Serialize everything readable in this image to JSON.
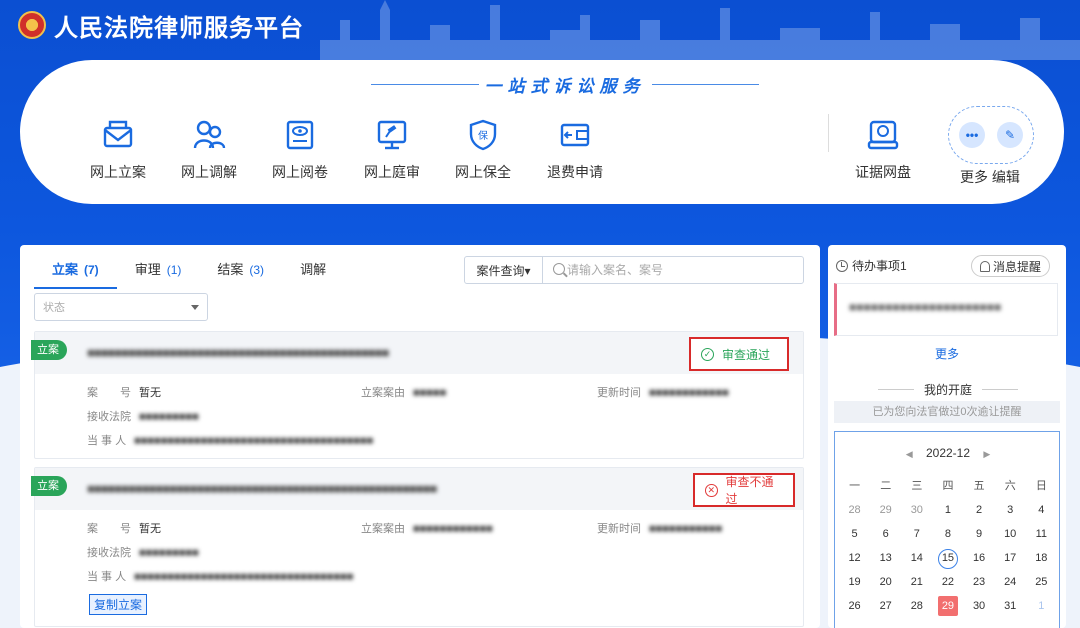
{
  "header": {
    "title": "人民法院律师服务平台"
  },
  "slogan": "一站式诉讼服务",
  "services": [
    {
      "label": "网上立案"
    },
    {
      "label": "网上调解"
    },
    {
      "label": "网上阅卷"
    },
    {
      "label": "网上庭审"
    },
    {
      "label": "网上保全"
    },
    {
      "label": "退费申请"
    },
    {
      "label": "证据网盘"
    }
  ],
  "more_edit": {
    "label": "更多 编辑",
    "dots": "•••",
    "pen": "✎"
  },
  "tabs": [
    {
      "label": "立案",
      "count": "(7)"
    },
    {
      "label": "审理",
      "count": "(1)"
    },
    {
      "label": "结案",
      "count": "(3)"
    },
    {
      "label": "调解",
      "count": ""
    }
  ],
  "search": {
    "type": "案件查询▾",
    "placeholder": "请输入案名、案号"
  },
  "status_filter": {
    "placeholder": "状态"
  },
  "cases": [
    {
      "badge": "立案",
      "title": "■■■■■■■■■■■■■■■■■■■■■■■■■■■■■■■■■■■■■■■■■■■■",
      "result": "审查通过",
      "result_icon": "✓",
      "case_no_label": "案　　号",
      "case_no": "暂无",
      "reason_label": "立案案由",
      "reason": "■■■■■",
      "update_label": "更新时间",
      "update": "■■■■■■■■■■■■",
      "court_label": "接收法院",
      "court": "■■■■■■■■■",
      "party_label": "当 事 人",
      "party": "■■■■■■■■■■■■■■■■■■■■■■■■■■■■■■■■■■■■"
    },
    {
      "badge": "立案",
      "title": "■■■■■■■■■■■■■■■■■■■■■■■■■■■■■■■■■■■■■■■■■■■■■■■■■■■",
      "result": "审查不通过",
      "result_icon": "✕",
      "case_no_label": "案　　号",
      "case_no": "暂无",
      "reason_label": "立案案由",
      "reason": "■■■■■■■■■■■■",
      "update_label": "更新时间",
      "update": "■■■■■■■■■■■",
      "court_label": "接收法院",
      "court": "■■■■■■■■■",
      "party_label": "当 事 人",
      "party": "■■■■■■■■■■■■■■■■■■■■■■■■■■■■■■■■■",
      "copy_label": "复制立案"
    }
  ],
  "side": {
    "todo_title": "待办事项1",
    "msg_btn": "消息提醒",
    "todo_item": "■■■■■■■■■■■■■■■■■■■■■",
    "more": "更多",
    "court_title": "我的开庭",
    "court_note": "已为您向法官做过0次逾让提醒",
    "calendar": {
      "month": "2022-12",
      "prev": "◀",
      "next": "▶",
      "weekdays": [
        "一",
        "二",
        "三",
        "四",
        "五",
        "六",
        "日"
      ],
      "weeks": [
        [
          "28",
          "29",
          "30",
          "1",
          "2",
          "3",
          "4"
        ],
        [
          "5",
          "6",
          "7",
          "8",
          "9",
          "10",
          "11"
        ],
        [
          "12",
          "13",
          "14",
          "15",
          "16",
          "17",
          "18"
        ],
        [
          "19",
          "20",
          "21",
          "22",
          "23",
          "24",
          "25"
        ],
        [
          "26",
          "27",
          "28",
          "29",
          "30",
          "31",
          "1"
        ]
      ]
    }
  },
  "colors": {
    "primary": "#1a6be0",
    "pass": "#2aa55a",
    "fail": "#e23b3b",
    "header_bg": "#0d57de"
  }
}
